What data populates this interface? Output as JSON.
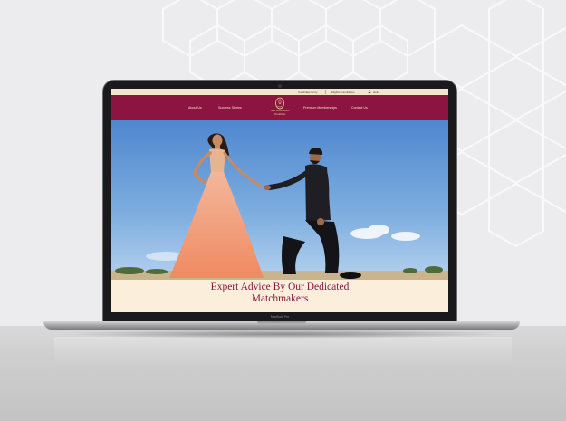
{
  "topbar": {
    "links": [
      "Candidate Entry",
      "Eligible Candidates",
      "Hello"
    ]
  },
  "nav": {
    "left_items": [
      "About Us",
      "Success Stories"
    ],
    "right_items": [
      "Premium Memberships",
      "Contact Us"
    ],
    "brand_name_line1": "Saat Kadamalos",
    "brand_name_line2": "Weddings"
  },
  "hero": {
    "caption_line1": "Expert Advice By Our Dedicated",
    "caption_line2": "Matchmakers"
  },
  "device": {
    "label": "MacBook Pro"
  },
  "colors": {
    "brand_maroon": "#8b1440",
    "brand_gold": "#e9cf9c",
    "caption_background": "#fbefdc",
    "topbar_background": "#efe7cc",
    "sky": "#6e9fd8"
  },
  "icons": [
    "user-icon",
    "brand-logo-icon"
  ]
}
